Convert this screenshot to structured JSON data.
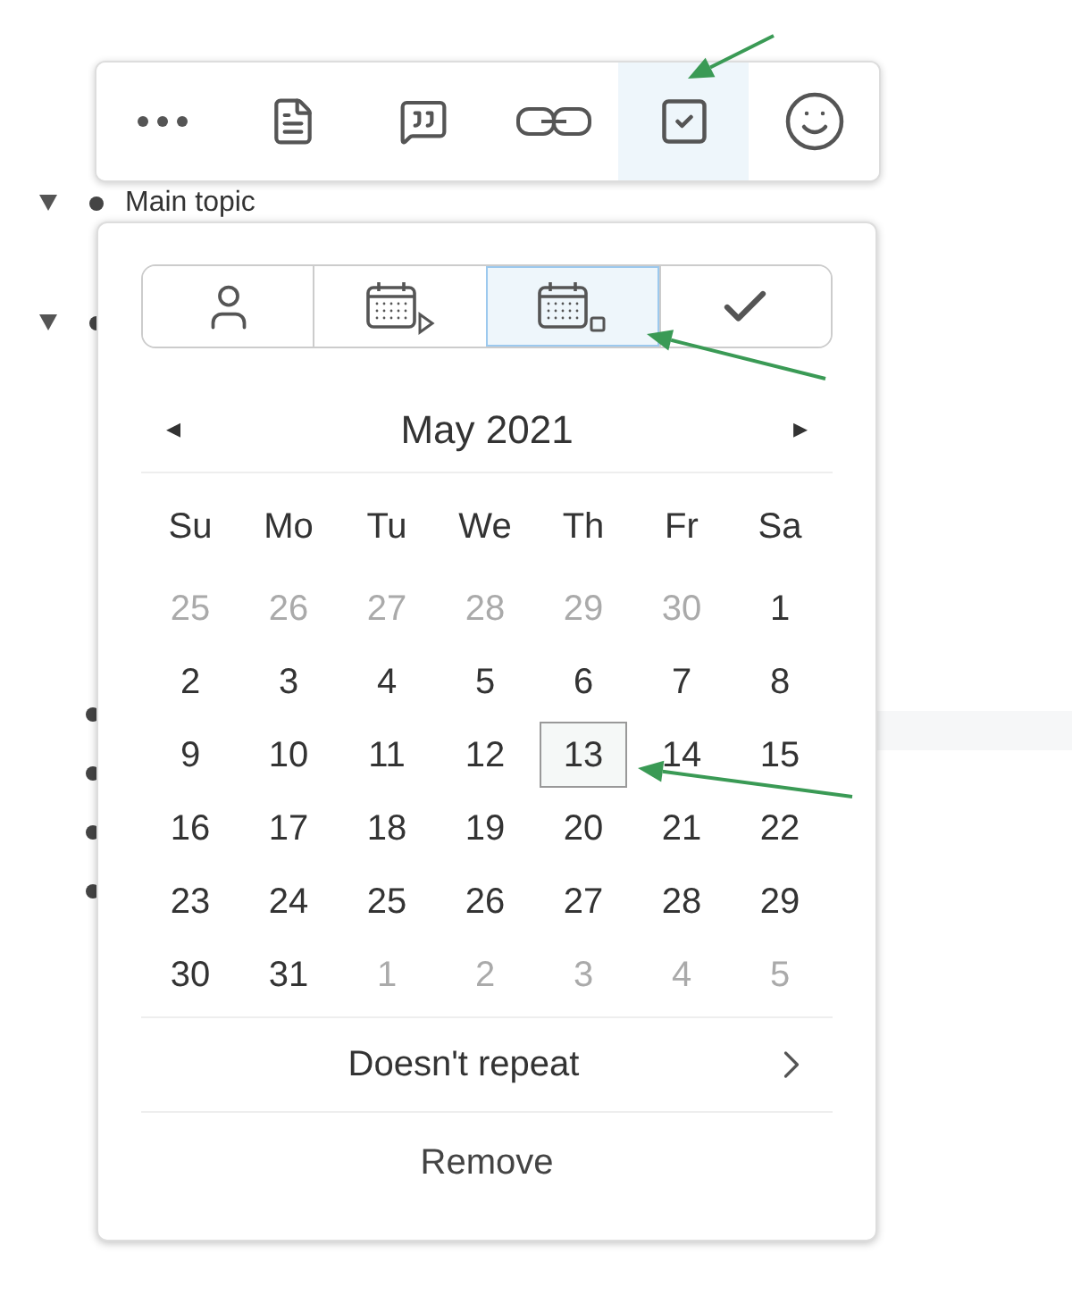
{
  "outline": {
    "items": [
      {
        "kind": "topic",
        "text": "Main topic",
        "expanded": true
      },
      {
        "kind": "topic",
        "expanded": true
      },
      {
        "kind": "leaf"
      },
      {
        "kind": "leaf"
      },
      {
        "kind": "leaf"
      },
      {
        "kind": "leaf"
      }
    ]
  },
  "toolbar": [
    {
      "kind": "more",
      "selected": false
    },
    {
      "kind": "note",
      "selected": false
    },
    {
      "kind": "comment",
      "selected": false
    },
    {
      "kind": "link",
      "selected": false
    },
    {
      "kind": "task",
      "selected": true
    },
    {
      "kind": "emoji",
      "selected": false
    }
  ],
  "mode_tabs": [
    {
      "kind": "person",
      "selected": false
    },
    {
      "kind": "start",
      "selected": false
    },
    {
      "kind": "due",
      "selected": true
    },
    {
      "kind": "done",
      "selected": false
    }
  ],
  "calendar": {
    "month": "May 2021",
    "prev": "◂",
    "next": "▸",
    "weekdays": [
      "Su",
      "Mo",
      "Tu",
      "We",
      "Th",
      "Fr",
      "Sa"
    ],
    "weeks": [
      [
        {
          "day": "25",
          "outside": true,
          "selected": false
        },
        {
          "day": "26",
          "outside": true,
          "selected": false
        },
        {
          "day": "27",
          "outside": true,
          "selected": false
        },
        {
          "day": "28",
          "outside": true,
          "selected": false
        },
        {
          "day": "29",
          "outside": true,
          "selected": false
        },
        {
          "day": "30",
          "outside": true,
          "selected": false
        },
        {
          "day": "1",
          "outside": false,
          "selected": false
        }
      ],
      [
        {
          "day": "2",
          "outside": false,
          "selected": false
        },
        {
          "day": "3",
          "outside": false,
          "selected": false
        },
        {
          "day": "4",
          "outside": false,
          "selected": false
        },
        {
          "day": "5",
          "outside": false,
          "selected": false
        },
        {
          "day": "6",
          "outside": false,
          "selected": false
        },
        {
          "day": "7",
          "outside": false,
          "selected": false
        },
        {
          "day": "8",
          "outside": false,
          "selected": false
        }
      ],
      [
        {
          "day": "9",
          "outside": false,
          "selected": false
        },
        {
          "day": "10",
          "outside": false,
          "selected": false
        },
        {
          "day": "11",
          "outside": false,
          "selected": false
        },
        {
          "day": "12",
          "outside": false,
          "selected": false
        },
        {
          "day": "13",
          "outside": false,
          "selected": true
        },
        {
          "day": "14",
          "outside": false,
          "selected": false
        },
        {
          "day": "15",
          "outside": false,
          "selected": false
        }
      ],
      [
        {
          "day": "16",
          "outside": false,
          "selected": false
        },
        {
          "day": "17",
          "outside": false,
          "selected": false
        },
        {
          "day": "18",
          "outside": false,
          "selected": false
        },
        {
          "day": "19",
          "outside": false,
          "selected": false
        },
        {
          "day": "20",
          "outside": false,
          "selected": false
        },
        {
          "day": "21",
          "outside": false,
          "selected": false
        },
        {
          "day": "22",
          "outside": false,
          "selected": false
        }
      ],
      [
        {
          "day": "23",
          "outside": false,
          "selected": false
        },
        {
          "day": "24",
          "outside": false,
          "selected": false
        },
        {
          "day": "25",
          "outside": false,
          "selected": false
        },
        {
          "day": "26",
          "outside": false,
          "selected": false
        },
        {
          "day": "27",
          "outside": false,
          "selected": false
        },
        {
          "day": "28",
          "outside": false,
          "selected": false
        },
        {
          "day": "29",
          "outside": false,
          "selected": false
        }
      ],
      [
        {
          "day": "30",
          "outside": false,
          "selected": false
        },
        {
          "day": "31",
          "outside": false,
          "selected": false
        },
        {
          "day": "1",
          "outside": true,
          "selected": false
        },
        {
          "day": "2",
          "outside": true,
          "selected": false
        },
        {
          "day": "3",
          "outside": true,
          "selected": false
        },
        {
          "day": "4",
          "outside": true,
          "selected": false
        },
        {
          "day": "5",
          "outside": true,
          "selected": false
        }
      ]
    ]
  },
  "repeat": {
    "label": "Doesn't repeat"
  },
  "remove": {
    "label": "Remove"
  }
}
